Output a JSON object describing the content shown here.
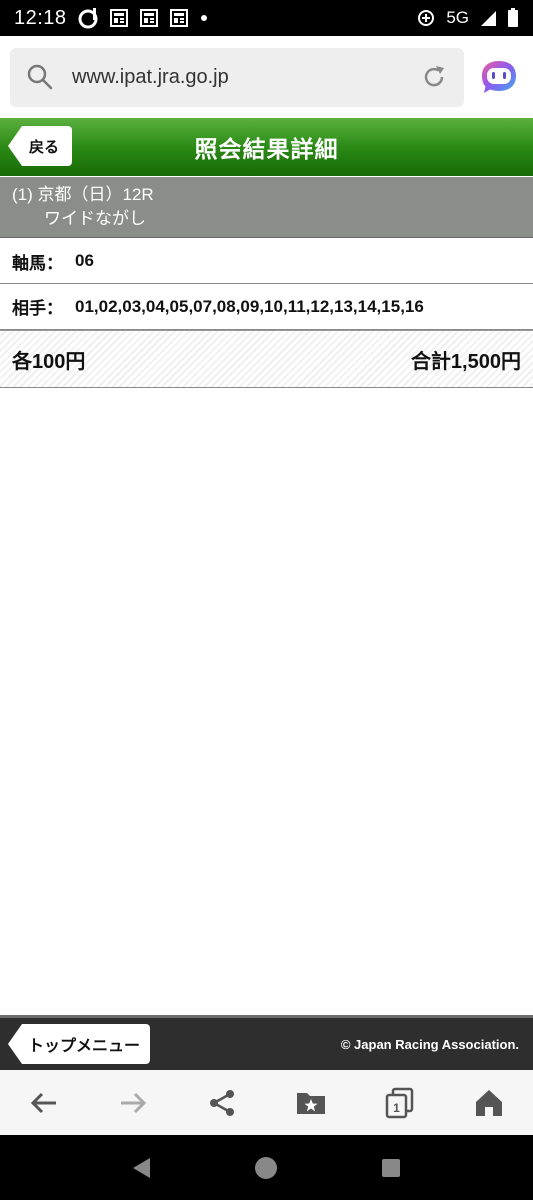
{
  "status_bar": {
    "time": "12:18",
    "network": "5G"
  },
  "browser": {
    "url": "www.ipat.jra.go.jp"
  },
  "header": {
    "back_label": "戻る",
    "title": "照会結果詳細"
  },
  "race": {
    "venue_line": "(1) 京都（日）12R",
    "bet_type": "ワイドながし"
  },
  "axis": {
    "label": "軸馬：",
    "value": "06"
  },
  "partners": {
    "label": "相手：",
    "value": "01,02,03,04,05,07,08,09,10,11,12,13,14,15,16"
  },
  "totals": {
    "each": "各100円",
    "total": "合計1,500円"
  },
  "footer": {
    "top_menu_label": "トップメニュー",
    "copyright": "© Japan Racing Association."
  },
  "toolbar": {
    "tabs_count": "1"
  },
  "colors": {
    "header_green": "#2b8a15",
    "race_gray": "#8a8d8a",
    "footer_dark": "#2e2e2e"
  }
}
